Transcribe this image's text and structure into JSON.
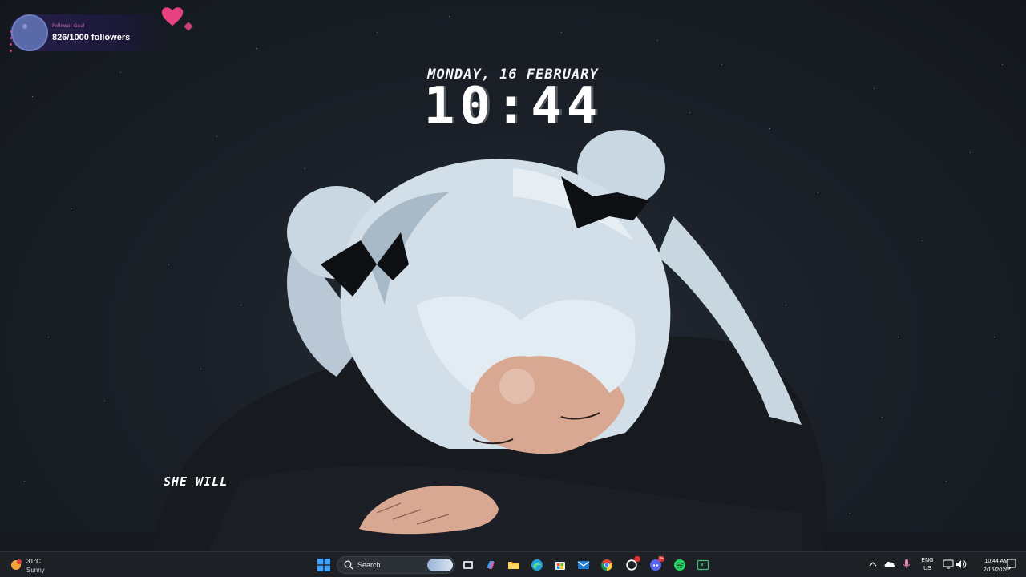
{
  "widget": {
    "title": "Follower Goal",
    "count": "826/1000 followers"
  },
  "clock": {
    "date": "MONDAY, 16 FEBRUARY",
    "time": "10:44"
  },
  "lyric": "SHE WILL",
  "taskbar": {
    "weather": {
      "temp": "31°C",
      "condition": "Sunny",
      "icon": "sun-icon"
    },
    "search": {
      "label": "Search"
    },
    "apps": [
      {
        "name": "start-button",
        "icon": "windows-icon"
      },
      {
        "name": "task-view-button",
        "icon": "task-view-icon"
      },
      {
        "name": "copilot-button",
        "icon": "copilot-icon"
      },
      {
        "name": "file-explorer-button",
        "icon": "folder-icon"
      },
      {
        "name": "edge-button",
        "icon": "edge-icon"
      },
      {
        "name": "store-button",
        "icon": "store-icon"
      },
      {
        "name": "outlook-button",
        "icon": "mail-icon"
      },
      {
        "name": "chrome-button",
        "icon": "chrome-icon"
      },
      {
        "name": "github-button",
        "icon": "github-icon"
      },
      {
        "name": "discord-button",
        "icon": "discord-icon"
      },
      {
        "name": "spotify-button",
        "icon": "spotify-icon"
      },
      {
        "name": "terminal-button",
        "icon": "terminal-icon"
      }
    ],
    "discord_badge": "9+",
    "language": {
      "line1": "ENG",
      "line2": "US"
    },
    "time": "10:44 AM",
    "date": "2/16/2026"
  },
  "colors": {
    "taskbar": "#1d2126",
    "accent_pink": "#e8417f",
    "text": "#ffffff"
  }
}
